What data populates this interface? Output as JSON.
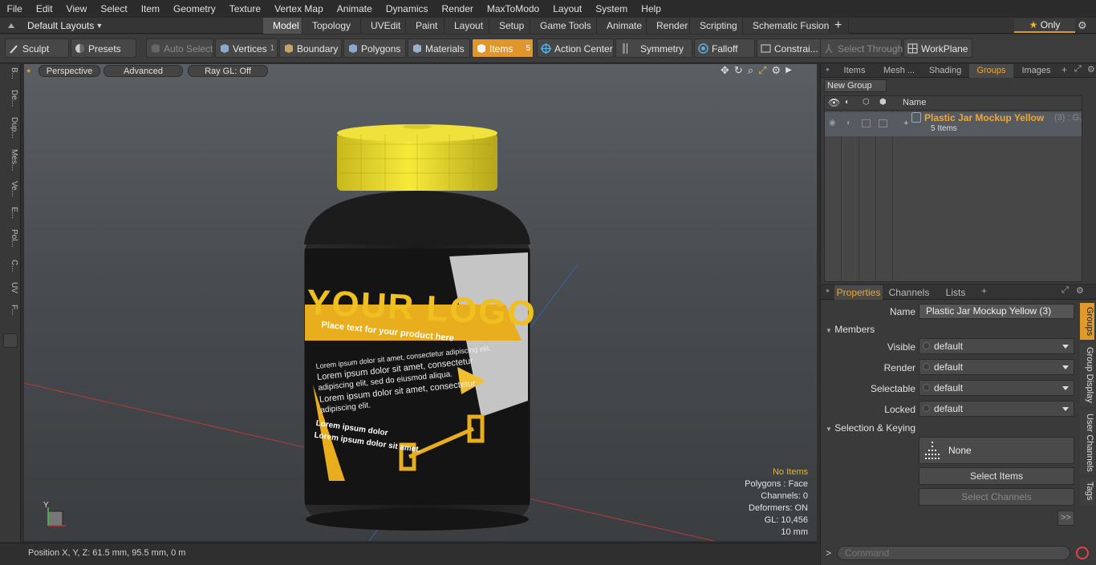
{
  "menu": [
    "File",
    "Edit",
    "View",
    "Select",
    "Item",
    "Geometry",
    "Texture",
    "Vertex Map",
    "Animate",
    "Dynamics",
    "Render",
    "MaxToModo",
    "Layout",
    "System",
    "Help"
  ],
  "layouts": {
    "selector": "Default Layouts",
    "tabs": [
      "Model",
      "Topology",
      "UVEdit",
      "Paint",
      "Layout",
      "Setup",
      "Game Tools",
      "Animate",
      "Render",
      "Scripting",
      "Schematic Fusion"
    ],
    "active_tab": "Model",
    "add": "+",
    "only": "Only",
    "close": "✕"
  },
  "toolbar": {
    "sculpt": "Sculpt",
    "presets": "Presets",
    "auto_select": "Auto Select",
    "vertices": "Vertices",
    "vertices_count": "1",
    "boundary": "Boundary",
    "polygons": "Polygons",
    "materials": "Materials",
    "items": "Items",
    "items_count": "5",
    "action_center": "Action Center",
    "symmetry": "Symmetry",
    "falloff": "Falloff",
    "constraints": "Constrai...",
    "select_through": "Select Through",
    "workplane": "WorkPlane"
  },
  "left_tabs": [
    "B...",
    "De...",
    "Dup...",
    "Mes...",
    "Ve...",
    "E...",
    "Pol...",
    "C...",
    "UV",
    "F..."
  ],
  "viewport": {
    "perspective": "Perspective",
    "advanced": "Advanced",
    "raygl": "Ray GL: Off",
    "info": {
      "no_items": "No Items",
      "polygons": "Polygons : Face",
      "channels": "Channels: 0",
      "deformers": "Deformers: ON",
      "gl": "GL: 10,456",
      "scale": "10 mm"
    },
    "jar": {
      "logo": "YOUR LOGO",
      "tagline": "Place text for your product here",
      "body1": "Lorem ipsum dolor sit amet, consectetur adipiscing elit.",
      "body2": "Lorem ipsum dolor sit amet, consectetur",
      "body3": "adipiscing elit, sed do eiusmod aliqua.",
      "body4": "Lorem ipsum dolor sit amet, consectetur",
      "body5": "adipiscing elit.",
      "bold1": "Lorem ipsum dolor",
      "bold2": "Lorem ipsum dolor sit amet."
    },
    "axis_y": "Y"
  },
  "status": {
    "position": "Position X, Y, Z:   61.5 mm, 95.5 mm, 0 m"
  },
  "right_top": {
    "tabs": [
      "Items",
      "Mesh ...",
      "Shading",
      "Groups",
      "Images"
    ],
    "active_tab": "Groups",
    "new_group": "New Group",
    "header_name": "Name",
    "group": {
      "name": "Plastic Jar Mockup Yellow",
      "suffix": "(3) : G...",
      "count": "5 Items"
    }
  },
  "properties": {
    "tabs": [
      "Properties",
      "Channels",
      "Lists"
    ],
    "active_tab": "Properties",
    "name_label": "Name",
    "name_value": "Plastic Jar Mockup Yellow (3)",
    "members_header": "Members",
    "fields": [
      {
        "label": "Visible",
        "value": "default"
      },
      {
        "label": "Render",
        "value": "default"
      },
      {
        "label": "Selectable",
        "value": "default"
      },
      {
        "label": "Locked",
        "value": "default"
      }
    ],
    "selection_header": "Selection & Keying",
    "keying_value": "None",
    "select_items": "Select Items",
    "select_channels": "Select Channels",
    "more": ">>",
    "side_tabs": [
      "Groups",
      "Group Display",
      "User Channels",
      "Tags"
    ]
  },
  "command": {
    "prompt": ">",
    "placeholder": "Command"
  },
  "colors": {
    "accent": "#e0962a",
    "group_name": "#f2a531",
    "jar_lid": "#f5e632",
    "jar_body": "#1e1e1e"
  }
}
